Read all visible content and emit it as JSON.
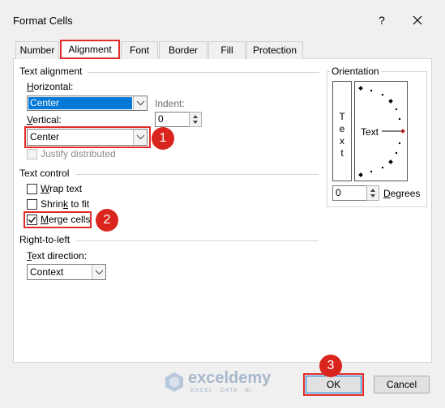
{
  "dialog": {
    "title": "Format Cells",
    "help": "?",
    "ok": "OK",
    "cancel": "Cancel"
  },
  "tabs": [
    {
      "label": "Number"
    },
    {
      "label": "Alignment"
    },
    {
      "label": "Font"
    },
    {
      "label": "Border"
    },
    {
      "label": "Fill"
    },
    {
      "label": "Protection"
    }
  ],
  "text_alignment": {
    "section": "Text alignment",
    "horizontal_label": "Horizontal:",
    "horizontal_value": "Center",
    "vertical_label": "Vertical:",
    "vertical_value": "Center",
    "indent_label": "Indent:",
    "indent_value": "0",
    "justify_label": "Justify distributed"
  },
  "text_control": {
    "section": "Text control",
    "wrap": "Wrap text",
    "shrink": "Shrink to fit",
    "merge": "Merge cells",
    "merge_checked": true
  },
  "rtl": {
    "section": "Right-to-left",
    "direction_label": "Text direction:",
    "direction_value": "Context"
  },
  "orientation": {
    "section": "Orientation",
    "vertical_text": [
      "T",
      "e",
      "x",
      "t"
    ],
    "text": "Text",
    "degrees_value": "0",
    "degrees_label": "Degrees"
  },
  "badges": [
    "1",
    "2",
    "3"
  ],
  "watermark": {
    "name": "exceldemy",
    "tagline": "EXCEL · DATA · BI"
  },
  "colors": {
    "accent_red": "#e32b2b",
    "badge_red": "#d9251d",
    "selection_blue": "#0078d7"
  }
}
